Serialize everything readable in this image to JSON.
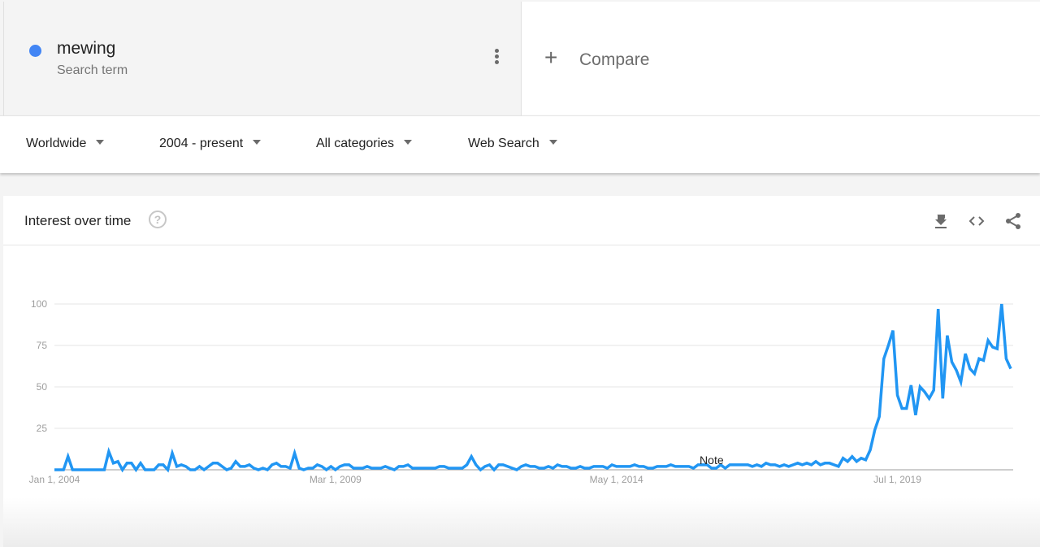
{
  "search_term": {
    "name": "mewing",
    "subtitle": "Search term",
    "color": "#4285f4",
    "menu_icon": "more-vert-icon"
  },
  "compare": {
    "icon": "plus-icon",
    "label": "Compare"
  },
  "filters": [
    {
      "label": "Worldwide"
    },
    {
      "label": "2004 - present"
    },
    {
      "label": "All categories"
    },
    {
      "label": "Web Search"
    }
  ],
  "panel": {
    "title": "Interest over time",
    "help_icon": "help-icon",
    "actions": [
      {
        "icon": "download-icon"
      },
      {
        "icon": "embed-code-icon"
      },
      {
        "icon": "share-icon"
      }
    ]
  },
  "chart_data": {
    "type": "line",
    "title": "Interest over time",
    "xlabel": "",
    "ylabel": "",
    "ylim": [
      0,
      100
    ],
    "yticks": [
      "25",
      "50",
      "75",
      "100"
    ],
    "ytick_values": [
      25,
      50,
      75,
      100
    ],
    "xticks": [
      "Jan 1, 2004",
      "Mar 1, 2009",
      "May 1, 2014",
      "Jul 1, 2019"
    ],
    "xtick_month_index": [
      0,
      62,
      124,
      186
    ],
    "grid": true,
    "line_color": "#2196f3",
    "annotation": {
      "text": "Note",
      "month_index": 145
    },
    "series": [
      {
        "name": "mewing",
        "start": "Jan 2004",
        "interval": "month",
        "values": [
          0,
          0,
          0,
          8,
          0,
          0,
          0,
          0,
          0,
          0,
          0,
          0,
          11,
          4,
          5,
          0,
          4,
          4,
          0,
          4,
          0,
          0,
          0,
          3,
          3,
          0,
          10,
          2,
          3,
          2,
          0,
          0,
          2,
          0,
          2,
          4,
          4,
          2,
          0,
          1,
          5,
          2,
          2,
          3,
          1,
          0,
          1,
          0,
          3,
          4,
          2,
          2,
          1,
          10,
          1,
          0,
          1,
          1,
          3,
          2,
          0,
          2,
          0,
          2,
          3,
          3,
          1,
          1,
          1,
          2,
          1,
          1,
          1,
          2,
          1,
          0,
          2,
          2,
          3,
          1,
          1,
          1,
          1,
          1,
          1,
          2,
          2,
          1,
          1,
          1,
          1,
          3,
          8,
          3,
          0,
          2,
          3,
          0,
          3,
          3,
          2,
          1,
          0,
          2,
          3,
          2,
          2,
          1,
          1,
          2,
          1,
          3,
          2,
          2,
          1,
          1,
          2,
          1,
          1,
          2,
          2,
          2,
          1,
          3,
          2,
          2,
          2,
          2,
          3,
          2,
          2,
          1,
          1,
          2,
          2,
          2,
          3,
          2,
          2,
          2,
          2,
          1,
          3,
          3,
          3,
          1,
          1,
          3,
          1,
          3,
          3,
          3,
          3,
          3,
          2,
          3,
          2,
          4,
          3,
          3,
          2,
          3,
          2,
          3,
          4,
          3,
          4,
          3,
          5,
          3,
          4,
          4,
          3,
          2,
          7,
          5,
          8,
          5,
          7,
          6,
          12,
          24,
          32,
          67,
          75,
          84,
          45,
          37,
          37,
          51,
          33,
          50,
          47,
          43,
          48,
          97,
          43,
          81,
          65,
          60,
          53,
          70,
          61,
          58,
          67,
          66,
          78,
          74,
          73,
          100,
          67,
          61
        ]
      }
    ]
  }
}
